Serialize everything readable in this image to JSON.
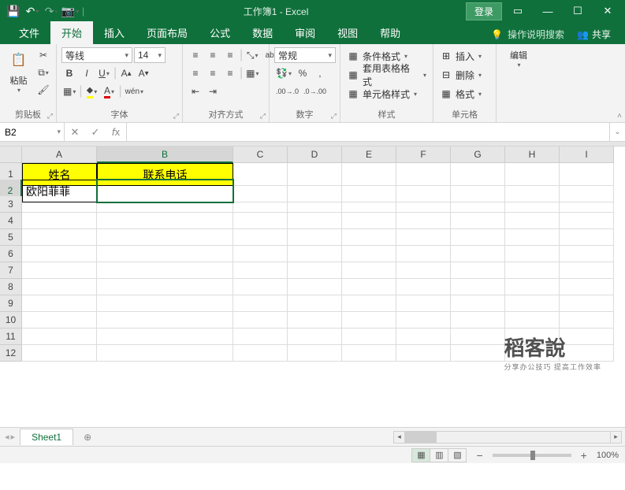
{
  "title": "工作簿1 - Excel",
  "login": "登录",
  "tabs": [
    "文件",
    "开始",
    "插入",
    "页面布局",
    "公式",
    "数据",
    "审阅",
    "视图",
    "帮助"
  ],
  "active_tab": 1,
  "tell_me": "操作说明搜索",
  "share": "共享",
  "ribbon": {
    "clipboard": {
      "paste": "粘贴",
      "label": "剪贴板"
    },
    "font": {
      "name": "等线",
      "size": "14",
      "label": "字体"
    },
    "align": {
      "label": "对齐方式"
    },
    "number": {
      "format": "常规",
      "label": "数字"
    },
    "styles": {
      "cond": "条件格式",
      "table": "套用表格格式",
      "cell": "单元格样式",
      "label": "样式"
    },
    "cells": {
      "insert": "插入",
      "delete": "删除",
      "format": "格式",
      "label": "单元格"
    },
    "editing": {
      "label": "编辑"
    }
  },
  "namebox": "B2",
  "columns": [
    "A",
    "B",
    "C",
    "D",
    "E",
    "F",
    "G",
    "H",
    "I"
  ],
  "active_col": 1,
  "active_row": 2,
  "rows": 12,
  "cells": {
    "A1": "姓名",
    "B1": "联系电话",
    "A2": "欧阳菲菲"
  },
  "sheet": "Sheet1",
  "zoom": "100%",
  "watermark": "稻客說",
  "watermark_sub": "分享办公技巧 提高工作效率"
}
